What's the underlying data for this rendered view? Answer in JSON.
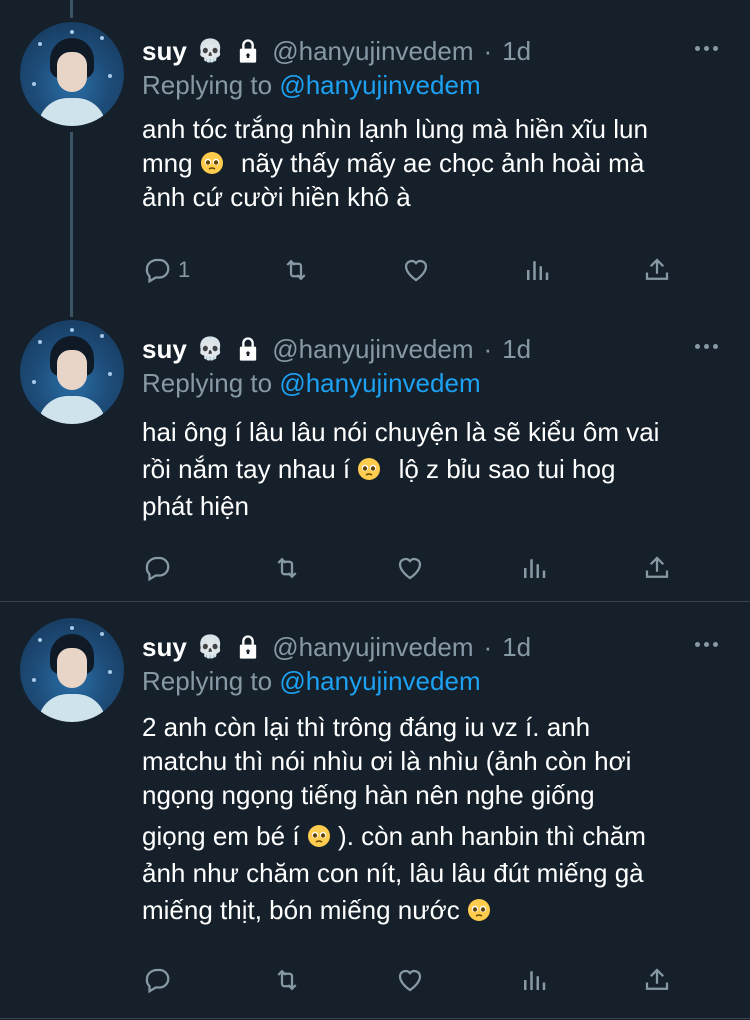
{
  "colors": {
    "background": "#15202b",
    "text_primary": "#ffffff",
    "text_secondary": "#8899a6",
    "mention": "#1da1f2",
    "divider": "#38444d"
  },
  "tweets": [
    {
      "name": "suy",
      "name_icons": [
        "skull-emoji",
        "lock-icon"
      ],
      "skull": "💀",
      "handle": "@hanyujinvedem",
      "dot": "·",
      "time": "1d",
      "reply_prefix": "Replying to",
      "reply_to": "@hanyujinvedem",
      "lines": [
        "anh tóc trắng nhìn lạnh lùng mà hiền xĩu lun",
        "mng",
        "nãy thấy mấy ae chọc ảnh hoài mà",
        "ảnh cứ cười hiền khô à"
      ],
      "reply_count": "1"
    },
    {
      "name": "suy",
      "name_icons": [
        "skull-emoji",
        "lock-icon"
      ],
      "skull": "💀",
      "handle": "@hanyujinvedem",
      "dot": "·",
      "time": "1d",
      "reply_prefix": "Replying to",
      "reply_to": "@hanyujinvedem",
      "lines": [
        "hai ông í lâu lâu nói chuyện là sẽ kiểu ôm vai",
        "rồi nắm tay nhau í",
        "lộ z bỉu sao tui hog",
        "phát hiện"
      ],
      "reply_count": ""
    },
    {
      "name": "suy",
      "name_icons": [
        "skull-emoji",
        "lock-icon"
      ],
      "skull": "💀",
      "handle": "@hanyujinvedem",
      "dot": "·",
      "time": "1d",
      "reply_prefix": "Replying to",
      "reply_to": "@hanyujinvedem",
      "lines": [
        "2 anh còn lại thì trông đáng iu vz í. anh",
        "matchu thì nói nhìu ơi là nhìu (ảnh còn hơi",
        "ngọng ngọng tiếng hàn nên nghe giống",
        "giọng em bé í",
        "). còn anh hanbin thì chăm",
        "ảnh như chăm con nít, lâu lâu đút miếng gà",
        "miếng thịt, bón miếng nước"
      ],
      "reply_count": ""
    }
  ]
}
